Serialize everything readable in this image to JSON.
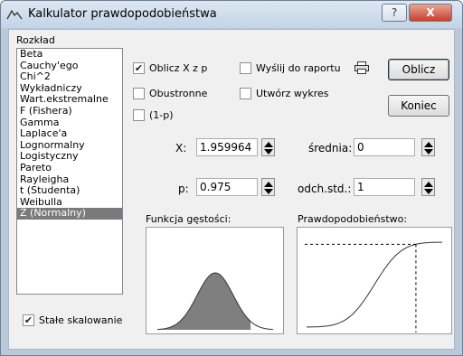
{
  "window": {
    "title": "Kalkulator prawdopodobieństwa",
    "help_label": "?",
    "close_label": "X"
  },
  "distribution": {
    "label": "Rozkład",
    "items": [
      "Beta",
      "Cauchy'ego",
      "Chi^2",
      "Wykładniczy",
      "Wart.ekstremalne",
      "F (Fishera)",
      "Gamma",
      "Laplace'a",
      "Lognormalny",
      "Logistyczny",
      "Pareto",
      "Rayleigha",
      "t (Studenta)",
      "Weibulla",
      "Z (Normalny)"
    ],
    "selected": "Z (Normalny)"
  },
  "options": {
    "compute_x_from_p": {
      "label": "Oblicz X z p",
      "checked": true
    },
    "two_sided": {
      "label": "Obustronne",
      "checked": false
    },
    "one_minus_p": {
      "label": "(1-p)",
      "checked": false
    },
    "send_to_report": {
      "label": "Wyślij do raportu",
      "checked": false
    },
    "create_graph": {
      "label": "Utwórz wykres",
      "checked": false
    },
    "fixed_scaling": {
      "label": "Stałe skalowanie",
      "checked": true
    }
  },
  "buttons": {
    "compute": "Oblicz",
    "close": "Koniec"
  },
  "fields": {
    "x": {
      "label": "X:",
      "value": "1.959964"
    },
    "p": {
      "label": "p:",
      "value": "0.975"
    },
    "mean": {
      "label": "średnia:",
      "value": "0"
    },
    "sd": {
      "label": "odch.std.:",
      "value": "1"
    }
  },
  "plots": {
    "density_label": "Funkcja gęstości:",
    "probability_label": "Prawdopodobieństwo:",
    "shaded_fraction": 0.975
  },
  "colors": {
    "shaded_area": "#7f7f7f",
    "window_frame": "#b9c9da",
    "client_bg": "#f0f0f0",
    "selected_item": "#7a7a7a"
  }
}
